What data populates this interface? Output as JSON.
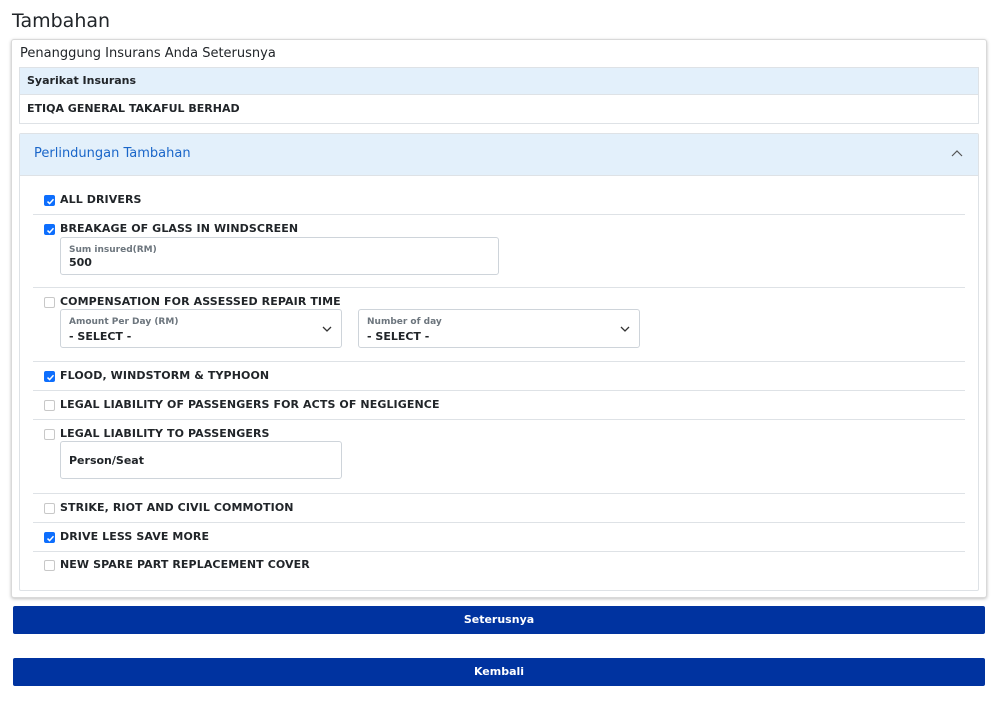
{
  "page_title": "Tambahan",
  "card": {
    "heading": "Penanggung Insurans Anda Seterusnya",
    "table": {
      "header": "Syarikat Insurans",
      "value": "ETIQA GENERAL TAKAFUL BERHAD"
    }
  },
  "accordion": {
    "title": "Perlindungan Tambahan",
    "expanded": true,
    "chevron_icon": "chevron-up-icon"
  },
  "options": [
    {
      "label": "ALL DRIVERS",
      "checked": true
    },
    {
      "label": "BREAKAGE OF GLASS IN WINDSCREEN",
      "checked": true,
      "fields": [
        {
          "label": "Sum insured(RM)",
          "value": "500"
        }
      ]
    },
    {
      "label": "COMPENSATION FOR ASSESSED REPAIR TIME",
      "checked": false,
      "fields": [
        {
          "label": "Amount Per Day (RM)",
          "value": "- SELECT -"
        },
        {
          "label": "Number of day",
          "value": "- SELECT -"
        }
      ]
    },
    {
      "label": "FLOOD, WINDSTORM & TYPHOON",
      "checked": true
    },
    {
      "label": "LEGAL LIABILITY OF PASSENGERS FOR ACTS OF NEGLIGENCE",
      "checked": false
    },
    {
      "label": "LEGAL LIABILITY TO PASSENGERS",
      "checked": false,
      "fields": [
        {
          "placeholder": "Person/Seat"
        }
      ]
    },
    {
      "label": "STRIKE, RIOT AND CIVIL COMMOTION",
      "checked": false
    },
    {
      "label": "DRIVE LESS SAVE MORE",
      "checked": true
    },
    {
      "label": "NEW SPARE PART REPLACEMENT COVER",
      "checked": false
    }
  ],
  "buttons": {
    "next": "Seterusnya",
    "back": "Kembali"
  },
  "colors": {
    "primary_button": "#0033a0",
    "checkbox_checked": "#0d6efd",
    "accordion_header_bg": "#e3f0fb",
    "link_blue": "#1a66c9"
  }
}
